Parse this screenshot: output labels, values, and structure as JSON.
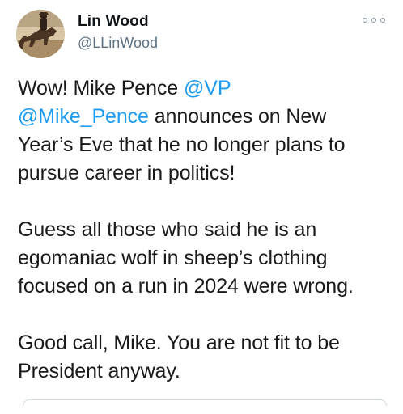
{
  "author": {
    "display_name": "Lin Wood",
    "handle": "@LLinWood",
    "avatar_icon": "horse-rider-avatar-icon"
  },
  "menu": {
    "icon": "more-options-icon"
  },
  "tweet": {
    "p1_l1_text": "Wow! Mike Pence ",
    "p1_l1_mention": "@VP",
    "p1_l2_mention": "@Mike_Pence",
    "p1_l2_text": " announces on New",
    "p1_l3": "Year’s Eve that he no longer plans to",
    "p1_l4": "pursue career in politics!",
    "p2_l1": "Guess all those who said he is an",
    "p2_l2": "egomaniac wolf in sheep’s clothing",
    "p2_l3": "focused on a run in 2024 were wrong.",
    "p3_l1": "Good call, Mike. You are not fit to be",
    "p3_l2": "President anyway."
  },
  "colors": {
    "mention": "#1d9bf0",
    "handle": "#5b7083",
    "text": "#1a1a1a"
  }
}
